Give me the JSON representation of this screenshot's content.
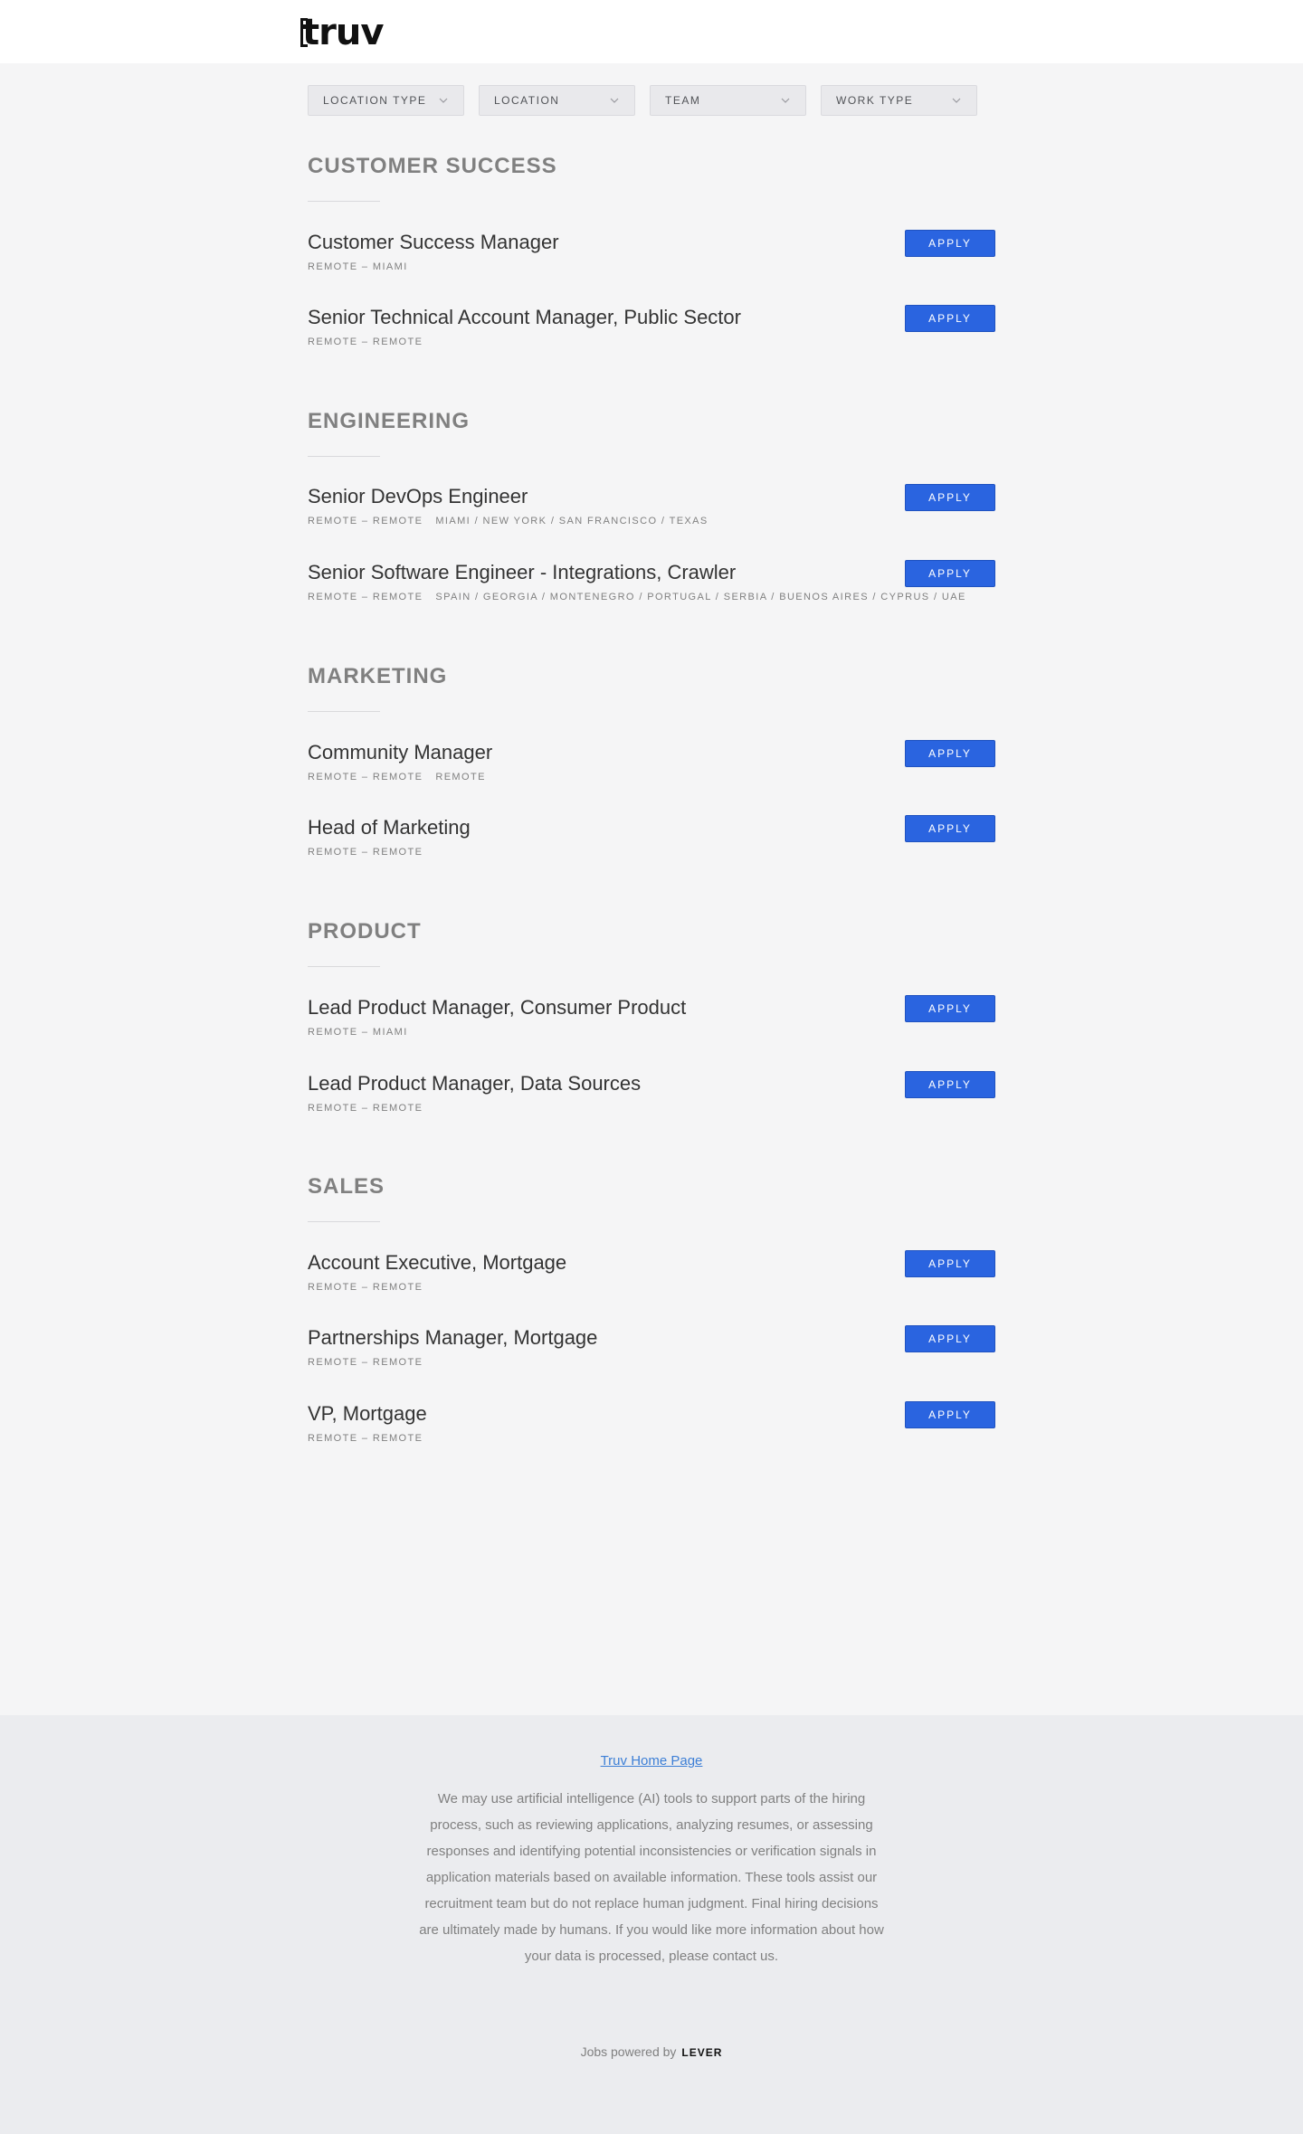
{
  "logo": {
    "text": "truv"
  },
  "filters": [
    {
      "label": "Location Type"
    },
    {
      "label": "Location"
    },
    {
      "label": "Team"
    },
    {
      "label": "Work Type"
    }
  ],
  "apply_label": "Apply",
  "sections": [
    {
      "title": "Customer Success",
      "postings": [
        {
          "title": "Customer Success Manager",
          "meta": "Remote – Miami",
          "locations": ""
        },
        {
          "title": "Senior Technical Account Manager, Public Sector",
          "meta": "Remote – Remote",
          "locations": ""
        }
      ]
    },
    {
      "title": "Engineering",
      "postings": [
        {
          "title": "Senior DevOps Engineer",
          "meta": "Remote – Remote",
          "locations": "Miami / New York / San Francisco / Texas"
        },
        {
          "title": "Senior Software Engineer - Integrations, Crawler",
          "meta": "Remote – Remote",
          "locations": "Spain / Georgia / Montenegro / Portugal / Serbia / Buenos Aires / Cyprus / UAE"
        }
      ]
    },
    {
      "title": "Marketing",
      "postings": [
        {
          "title": "Community Manager",
          "meta": "Remote – Remote",
          "locations": "Remote"
        },
        {
          "title": "Head of Marketing",
          "meta": "Remote – Remote",
          "locations": ""
        }
      ]
    },
    {
      "title": "Product",
      "postings": [
        {
          "title": "Lead Product Manager, Consumer Product",
          "meta": "Remote – Miami",
          "locations": ""
        },
        {
          "title": "Lead Product Manager, Data Sources",
          "meta": "Remote – Remote",
          "locations": ""
        }
      ]
    },
    {
      "title": "Sales",
      "postings": [
        {
          "title": "Account Executive, Mortgage",
          "meta": "Remote – Remote",
          "locations": ""
        },
        {
          "title": "Partnerships Manager, Mortgage",
          "meta": "Remote – Remote",
          "locations": ""
        },
        {
          "title": "VP, Mortgage",
          "meta": "Remote – Remote",
          "locations": ""
        }
      ]
    }
  ],
  "footer": {
    "home_link": "Truv Home Page",
    "ai_notice": "We may use artificial intelligence (AI) tools to support parts of the hiring process, such as reviewing applications, analyzing resumes, or assessing responses and identifying potential inconsistencies or verification signals in application materials based on available information. These tools assist our recruitment team but do not replace human judgment. Final hiring decisions are ultimately made by humans. If you would like more information about how your data is processed, please contact us.",
    "powered_by": "Jobs powered by",
    "powered_brand": "LEVER"
  },
  "colors": {
    "apply_button": "#2a64e0",
    "link": "#3d7fd6",
    "background": "#f5f5f6",
    "footer_bg": "#ebecef"
  }
}
